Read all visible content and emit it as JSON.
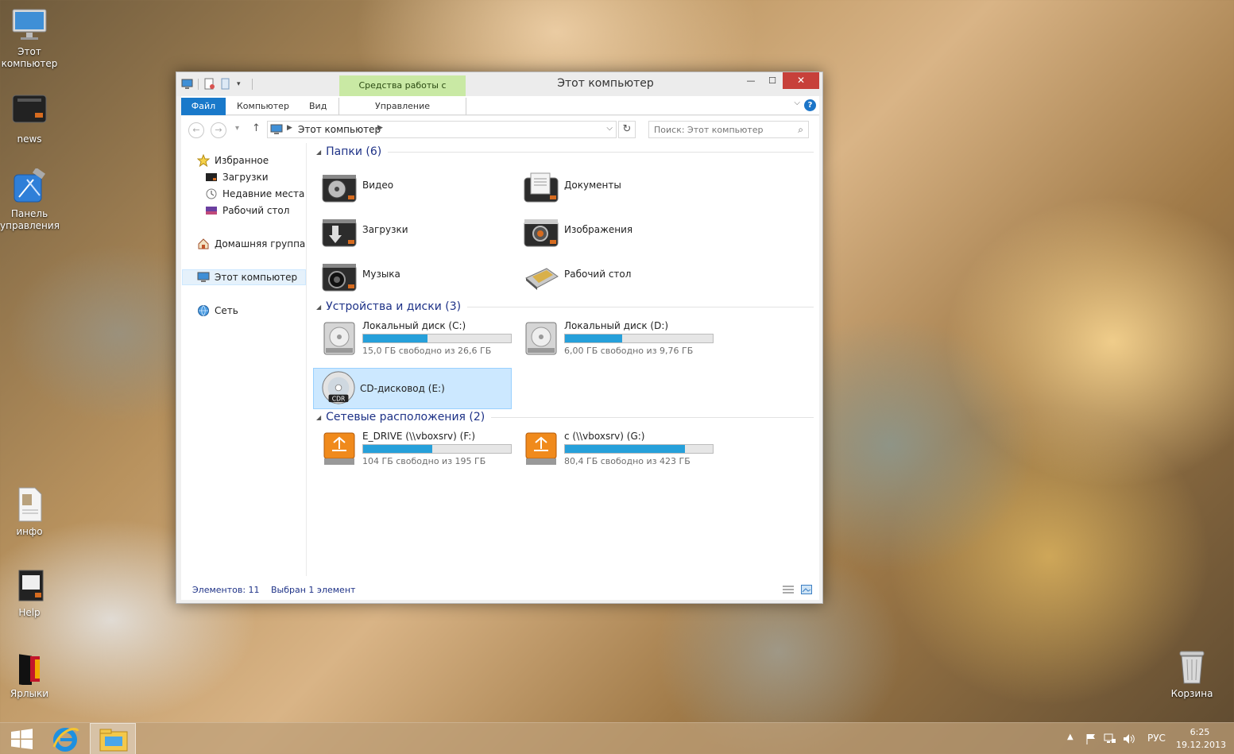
{
  "desktop": {
    "icons": [
      {
        "label": "Этот компьютер",
        "icon": "monitor-icon"
      },
      {
        "label": "news",
        "icon": "hdd-icon"
      },
      {
        "label": "Панель управления",
        "icon": "xcode-tools-icon"
      },
      {
        "label": "инфо",
        "icon": "document-icon"
      },
      {
        "label": "Help",
        "icon": "book-icon"
      },
      {
        "label": "Ярлыки",
        "icon": "shortcuts-icon"
      },
      {
        "label": "Корзина",
        "icon": "recycle-bin-icon"
      }
    ]
  },
  "window": {
    "title": "Этот компьютер",
    "context_tab": "Средства работы с дисками",
    "controls": {
      "minimize": "—",
      "maximize": "☐",
      "close": "✕"
    },
    "ribbon_tabs": [
      {
        "label": "Файл"
      },
      {
        "label": "Компьютер"
      },
      {
        "label": "Вид"
      },
      {
        "label": "Управление"
      }
    ],
    "help": "?",
    "address": {
      "path": "Этот компьютер"
    },
    "search": {
      "placeholder": "Поиск: Этот компьютер"
    }
  },
  "sidebar": {
    "favorites": {
      "label": "Избранное"
    },
    "favorites_items": [
      {
        "label": "Загрузки"
      },
      {
        "label": "Недавние места"
      },
      {
        "label": "Рабочий стол"
      }
    ],
    "homegroup": {
      "label": "Домашняя группа"
    },
    "this_pc": {
      "label": "Этот компьютер"
    },
    "network": {
      "label": "Сеть"
    }
  },
  "groups": {
    "folders": {
      "title": "Папки (6)"
    },
    "devices": {
      "title": "Устройства и диски (3)"
    },
    "network": {
      "title": "Сетевые расположения (2)"
    }
  },
  "folders": [
    {
      "name": "Видео",
      "icon": "video-folder-icon"
    },
    {
      "name": "Документы",
      "icon": "documents-folder-icon"
    },
    {
      "name": "Загрузки",
      "icon": "downloads-folder-icon"
    },
    {
      "name": "Изображения",
      "icon": "pictures-folder-icon"
    },
    {
      "name": "Музыка",
      "icon": "music-folder-icon"
    },
    {
      "name": "Рабочий стол",
      "icon": "desktop-folder-icon"
    }
  ],
  "drives": [
    {
      "name": "Локальный диск (C:)",
      "free": "15,0 ГБ свободно из 26,6 ГБ",
      "used_fraction": 0.436
    },
    {
      "name": "Локальный диск (D:)",
      "free": "6,00 ГБ свободно из 9,76 ГБ",
      "used_fraction": 0.385
    },
    {
      "name": "CD-дисковод (E:)"
    }
  ],
  "network_drives": [
    {
      "name": "E_DRIVE (\\\\vboxsrv) (F:)",
      "free": "104 ГБ свободно из 195 ГБ",
      "used_fraction": 0.467
    },
    {
      "name": "c (\\\\vboxsrv) (G:)",
      "free": "80,4 ГБ свободно из 423 ГБ",
      "used_fraction": 0.81
    }
  ],
  "status": {
    "items": "Элементов: 11",
    "selected": "Выбран 1 элемент"
  },
  "taskbar": {
    "language": "РУС",
    "time": "6:25",
    "date": "19.12.2013"
  },
  "colors": {
    "accent": "#1979ca",
    "progress": "#26a0da",
    "context_tab": "#c9e9a4",
    "close": "#c7403a"
  }
}
